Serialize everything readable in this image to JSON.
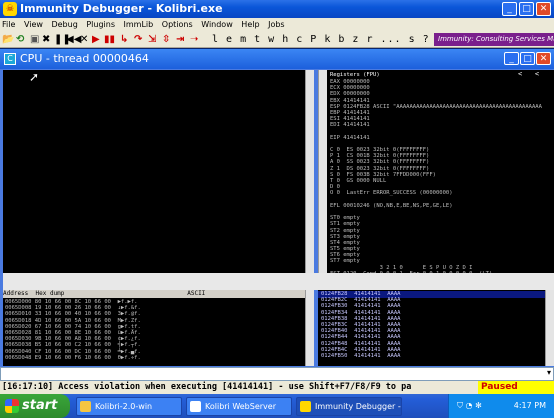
{
  "window": {
    "title": "Immunity Debugger - Kolibri.exe",
    "min": "_",
    "max": "□",
    "close": "✕"
  },
  "menu": [
    "File",
    "View",
    "Debug",
    "Plugins",
    "ImmLib",
    "Options",
    "Window",
    "Help",
    "Jobs"
  ],
  "toolbar": {
    "letters": "l e m t w h c P k b z r ... s ?",
    "banner": "Immunity: Consulting Services Ma"
  },
  "cpu": {
    "title": "CPU - thread 00000464"
  },
  "registers": {
    "header": "Registers (FPU)",
    "lines": [
      "EAX 00000000",
      "ECX 00000000",
      "EDX 00000000",
      "EBX 41414141",
      "ESP 0124FB28 ASCII \"AAAAAAAAAAAAAAAAAAAAAAAAAAAAAAAAAAAAAAAAAAAA",
      "EBP 41414141",
      "ESI 41414141",
      "EDI 41414141",
      "",
      "EIP 41414141",
      "",
      "C 0  ES 0023 32bit 0(FFFFFFFF)",
      "P 1  CS 001B 32bit 0(FFFFFFFF)",
      "A 0  SS 0023 32bit 0(FFFFFFFF)",
      "Z 1  DS 0023 32bit 0(FFFFFFFF)",
      "S 0  FS 003B 32bit 7FFDD000(FFF)",
      "T 0  GS 0000 NULL",
      "D 0",
      "O 0  LastErr ERROR_SUCCESS (00000000)",
      "",
      "EFL 00010246 (NO,NB,E,BE,NS,PE,GE,LE)",
      "",
      "ST0 empty",
      "ST1 empty",
      "ST2 empty",
      "ST3 empty",
      "ST4 empty",
      "ST5 empty",
      "ST6 empty",
      "ST7 empty",
      "               3 2 1 0      E S P U O Z D I",
      "FST 0120  Cond 0 0 0 1  Err 0 0 1 0 0 0 0 0  (LT)",
      "FCW 027F  Prec NEAR,53  Mask    1 1 1 1 1 1"
    ]
  },
  "dump": {
    "header": "Address  Hex dump                                  ASCII",
    "lines": [
      "0065D000 80 10 66 00 8C 10 66 00  ▶f.▶f.",
      "0065D008 19 10 66 00 26 10 66 00  ↓▶f.&f.",
      "0065D010 33 10 66 00 40 10 66 00  3▶f.@f.",
      "0065D018 4D 10 66 00 5A 10 66 00  M▶f.Zf.",
      "0065D020 67 10 66 00 74 10 66 00  g▶f.tf.",
      "0065D028 81 10 66 00 8E 10 66 00  ü▶f.Äf.",
      "0065D030 9B 10 66 00 A8 10 66 00  ¢▶f.¿f.",
      "0065D038 B5 10 66 00 C2 10 66 00  ╡▶f.┬f.",
      "0065D040 CF 10 66 00 DC 10 66 00  ╧▶f.▄f.",
      "0065D048 E9 10 66 00 F6 10 66 00  Θ▶f.÷f."
    ]
  },
  "stack": {
    "lines": [
      "0124FB28  41414141  AAAA",
      "0124FB2C  41414141  AAAA",
      "0124FB30  41414141  AAAA",
      "0124FB34  41414141  AAAA",
      "0124FB38  41414141  AAAA",
      "0124FB3C  41414141  AAAA",
      "0124FB40  41414141  AAAA",
      "0124FB44  41414141  AAAA",
      "0124FB48  41414141  AAAA",
      "0124FB4C  41414141  AAAA",
      "0124FB50  41414141  AAAA"
    ]
  },
  "status": {
    "message": "[16:17:10] Access violation when executing [41414141] - use Shift+F7/F8/F9 to pa",
    "state": "Paused"
  },
  "taskbar": {
    "start": "start",
    "tasks": [
      "Kolibri-2.0-win",
      "Kolibri WebServer",
      "Immunity Debugger - ..."
    ],
    "clock": "4:17 PM"
  }
}
